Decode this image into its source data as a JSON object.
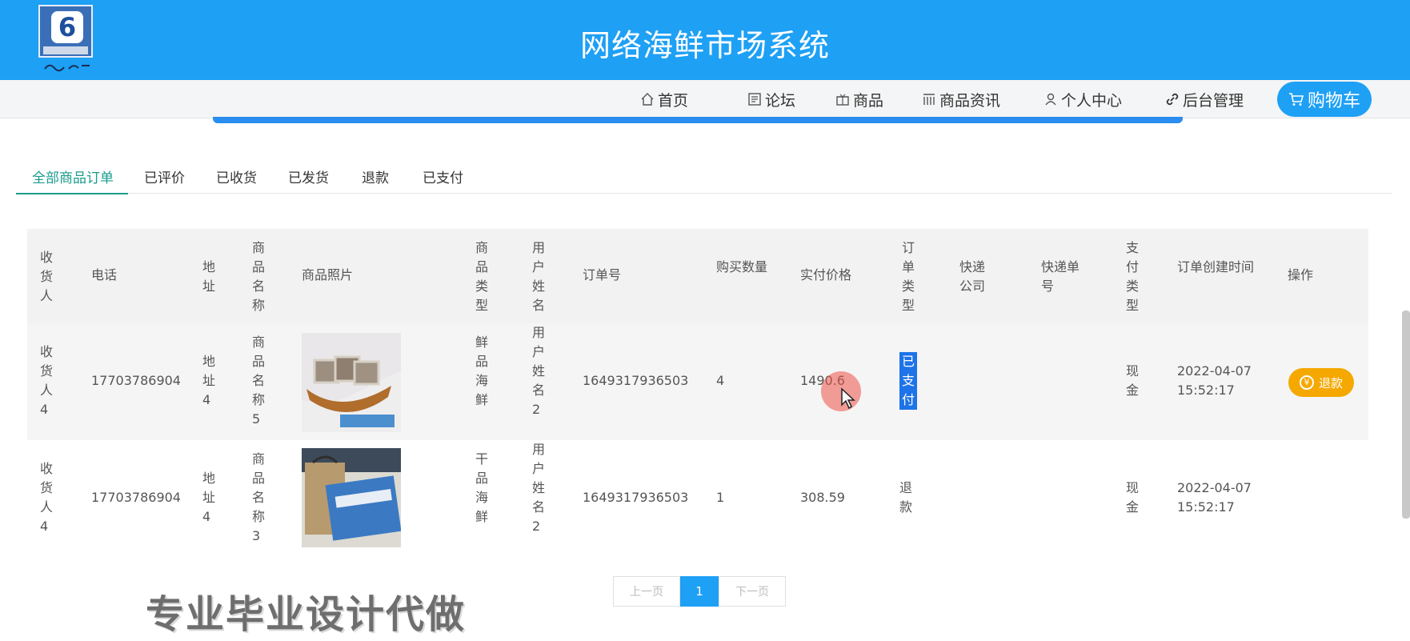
{
  "header": {
    "title": "网络海鲜市场系统",
    "logo_text": "6"
  },
  "nav": {
    "items": [
      {
        "label": "首页",
        "icon": "home-icon"
      },
      {
        "label": "论坛",
        "icon": "forum-icon"
      },
      {
        "label": "商品",
        "icon": "goods-icon"
      },
      {
        "label": "商品资讯",
        "icon": "news-icon"
      },
      {
        "label": "个人中心",
        "icon": "user-icon"
      },
      {
        "label": "后台管理",
        "icon": "link-icon"
      }
    ],
    "cart_label": "购物车"
  },
  "tabs": [
    "全部商品订单",
    "已评价",
    "已收货",
    "已发货",
    "退款",
    "已支付"
  ],
  "table": {
    "headers": {
      "receiver": "收货人",
      "phone": "电话",
      "address": "地址",
      "product_name": "商品名称",
      "photo": "商品照片",
      "product_type": "商品类型",
      "username": "用户姓名",
      "order_no": "订单号",
      "quantity": "购买数量",
      "price": "实付价格",
      "order_type": "订单类型",
      "courier": "快递公司",
      "tracking_no": "快递单号",
      "pay_type": "支付类型",
      "created": "订单创建时间",
      "action": "操作"
    },
    "rows": [
      {
        "receiver": "收货人4",
        "phone": "17703786904",
        "address": "地址4",
        "product_name": "商品名称5",
        "product_type": "鲜品海鲜",
        "username": "用户姓名2",
        "order_no": "1649317936503",
        "quantity": "4",
        "price": "1490.6",
        "order_type": "已支付",
        "courier": "",
        "tracking_no": "",
        "pay_type": "现金",
        "created_date": "2022-04-07",
        "created_time": "15:52:17",
        "action_label": "退款"
      },
      {
        "receiver": "收货人4",
        "phone": "17703786904",
        "address": "地址4",
        "product_name": "商品名称3",
        "product_type": "干品海鲜",
        "username": "用户姓名2",
        "order_no": "1649317936503",
        "quantity": "1",
        "price": "308.59",
        "order_type": "退款",
        "courier": "",
        "tracking_no": "",
        "pay_type": "现金",
        "created_date": "2022-04-07",
        "created_time": "15:52:17",
        "action_label": ""
      }
    ]
  },
  "pagination": {
    "prev": "上一页",
    "current": "1",
    "next": "下一页"
  },
  "watermark": "专业毕业设计代做",
  "colors": {
    "primary": "#1ea0f5",
    "tab_active": "#1a9c8c",
    "refund_button": "#f5a800",
    "selection": "#1e73e8"
  }
}
